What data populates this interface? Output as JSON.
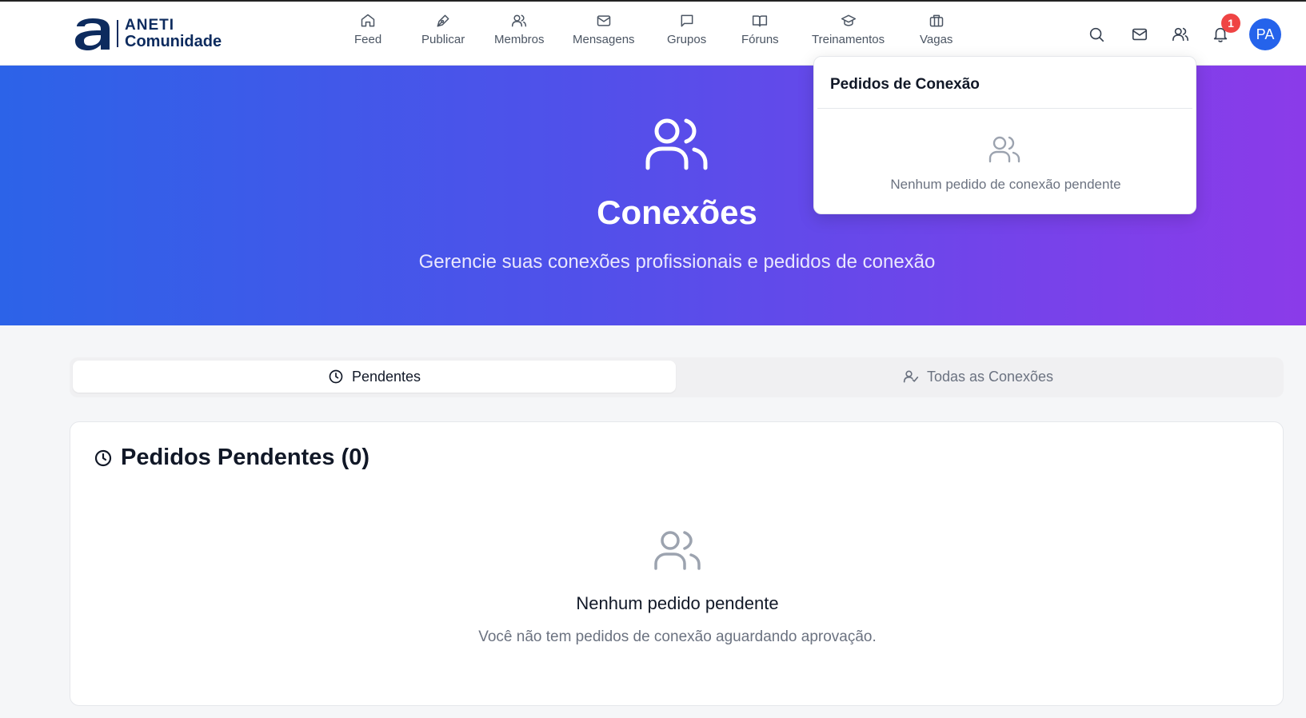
{
  "brand": {
    "line1": "ANETI",
    "line2": "Comunidade",
    "color": "#0d2b5e"
  },
  "nav": {
    "items": [
      {
        "label": "Feed",
        "icon": "home-icon"
      },
      {
        "label": "Publicar",
        "icon": "pen-icon"
      },
      {
        "label": "Membros",
        "icon": "users-icon"
      },
      {
        "label": "Mensagens",
        "icon": "mail-icon"
      },
      {
        "label": "Grupos",
        "icon": "message-square-icon"
      },
      {
        "label": "Fóruns",
        "icon": "book-open-icon"
      },
      {
        "label": "Treinamentos",
        "icon": "graduation-cap-icon"
      },
      {
        "label": "Vagas",
        "icon": "briefcase-icon"
      }
    ]
  },
  "header_actions": {
    "notification_count": "1",
    "avatar_initials": "PA",
    "avatar_color": "#2563eb",
    "badge_color": "#ef4444"
  },
  "hero": {
    "title": "Conexões",
    "subtitle": "Gerencie suas conexões profissionais e pedidos de conexão",
    "gradient_start": "#2c63e8",
    "gradient_end": "#8b3be9"
  },
  "tabs": [
    {
      "label": "Pendentes",
      "icon": "clock-icon",
      "active": true
    },
    {
      "label": "Todas as Conexões",
      "icon": "user-check-icon",
      "active": false
    }
  ],
  "pending": {
    "title": "Pedidos Pendentes (0)",
    "empty_title": "Nenhum pedido pendente",
    "empty_subtitle": "Você não tem pedidos de conexão aguardando aprovação."
  },
  "dropdown": {
    "title": "Pedidos de Conexão",
    "empty_text": "Nenhum pedido de conexão pendente"
  }
}
